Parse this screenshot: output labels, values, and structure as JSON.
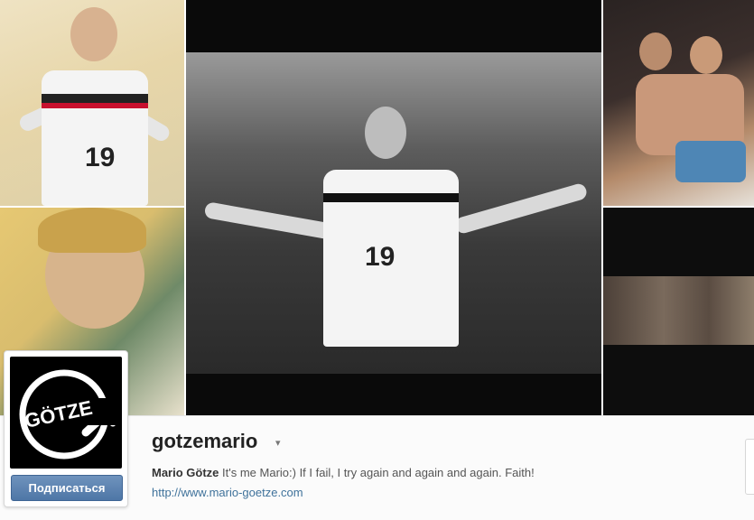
{
  "tiles": {
    "top_left_number": "19",
    "main_number": "19"
  },
  "profile": {
    "logo_text": "GÖTZE",
    "follow_label": "Подписаться",
    "username": "gotzemario",
    "dropdown_glyph": "▾",
    "bio_name": "Mario Götze",
    "bio_text": " It's me Mario:) If I fail, I try again and again and again. Faith!",
    "website": "http://www.mario-goetze.com"
  },
  "colors": {
    "follow_button": "#4e76a6",
    "link": "#3f729b"
  }
}
